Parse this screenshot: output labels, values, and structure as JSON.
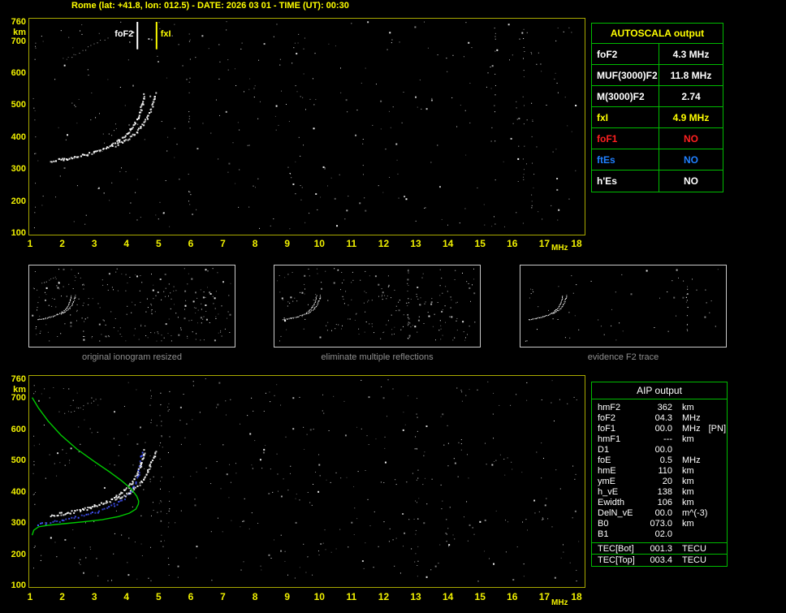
{
  "title": "Rome (lat: +41.8, lon: 012.5) - DATE: 2026 03 01 - TIME (UT): 00:30",
  "colors": {
    "axis_label": "#f0f000",
    "plot_border": "#a8a800",
    "table_border": "#00bb00",
    "trace": "#ffffff",
    "profile": "#00cc00",
    "restored_trace": "#4455ff",
    "caption": "#8f8f8f"
  },
  "autoscala_table": {
    "header": "AUTOSCALA output",
    "rows": [
      {
        "label": "foF2",
        "value": "4.3 MHz",
        "color": "#ffffff"
      },
      {
        "label": "MUF(3000)F2",
        "value": "11.8 MHz",
        "color": "#ffffff"
      },
      {
        "label": "M(3000)F2",
        "value": "2.74",
        "color": "#ffffff"
      },
      {
        "label": "fxI",
        "value": "4.9 MHz",
        "color": "#ffff00"
      },
      {
        "label": "foF1",
        "value": "NO",
        "color": "#ff2020"
      },
      {
        "label": "ftEs",
        "value": "NO",
        "color": "#2080ff"
      },
      {
        "label": "h'Es",
        "value": "NO",
        "color": "#ffffff"
      }
    ]
  },
  "aip_table": {
    "header": "AIP output",
    "rows": [
      {
        "label": "hmF2",
        "value": "362",
        "unit": "km",
        "note": ""
      },
      {
        "label": "foF2",
        "value": "04.3",
        "unit": "MHz",
        "note": ""
      },
      {
        "label": "foF1",
        "value": "00.0",
        "unit": "MHz",
        "note": "[PN]"
      },
      {
        "label": "hmF1",
        "value": "---",
        "unit": "km",
        "note": ""
      },
      {
        "label": "D1",
        "value": "00.0",
        "unit": "",
        "note": ""
      },
      {
        "label": "foE",
        "value": "0.5",
        "unit": "MHz",
        "note": ""
      },
      {
        "label": "hmE",
        "value": "110",
        "unit": "km",
        "note": ""
      },
      {
        "label": "ymE",
        "value": "20",
        "unit": "km",
        "note": ""
      },
      {
        "label": "h_vE",
        "value": "138",
        "unit": "km",
        "note": ""
      },
      {
        "label": "Ewidth",
        "value": "106",
        "unit": "km",
        "note": ""
      },
      {
        "label": "DelN_vE",
        "value": "00.0",
        "unit": "m^(-3)",
        "note": ""
      },
      {
        "label": "B0",
        "value": "073.0",
        "unit": "km",
        "note": ""
      },
      {
        "label": "B1",
        "value": "02.0",
        "unit": "",
        "note": ""
      }
    ],
    "tec_rows": [
      {
        "label": "TEC[Bot]",
        "value": "001.3",
        "unit": "TECU"
      },
      {
        "label": "TEC[Top]",
        "value": "003.4",
        "unit": "TECU"
      }
    ]
  },
  "thumbnails": [
    {
      "caption": "original ionogram resized"
    },
    {
      "caption": "eliminate multiple reflections"
    },
    {
      "caption": "evidence F2 trace"
    }
  ],
  "chart_data": [
    {
      "id": "ionogram_top",
      "type": "scatter",
      "title": "recorded ionogram",
      "xlabel": "MHz",
      "ylabel": "km",
      "xlim": [
        1,
        18
      ],
      "ylim": [
        100,
        760
      ],
      "xticks": [
        1,
        2,
        3,
        4,
        5,
        6,
        7,
        8,
        9,
        10,
        11,
        12,
        13,
        14,
        15,
        16,
        17,
        18
      ],
      "yticks": [
        760,
        700,
        600,
        500,
        400,
        300,
        200,
        100
      ],
      "grid": false,
      "markers": [
        {
          "label": "foF2",
          "freq_mhz": 4.3,
          "color": "#ffffff"
        },
        {
          "label": "fxI",
          "freq_mhz": 4.9,
          "color": "#ffff00"
        }
      ],
      "series": [
        {
          "name": "second-hop-reflection",
          "color": "#e8e8e8",
          "draw": "faint",
          "points": [
            [
              1.95,
              648
            ],
            [
              2.15,
              655
            ],
            [
              2.35,
              663
            ],
            [
              2.55,
              673
            ],
            [
              2.75,
              684
            ],
            [
              2.95,
              696
            ],
            [
              3.15,
              707
            ],
            [
              3.4,
              716
            ]
          ]
        },
        {
          "name": "F2-trace-ordinary",
          "color": "#ffffff",
          "draw": "dots",
          "points": [
            [
              1.55,
              328
            ],
            [
              1.7,
              330
            ],
            [
              1.9,
              333
            ],
            [
              2.1,
              336
            ],
            [
              2.3,
              340
            ],
            [
              2.5,
              345
            ],
            [
              2.7,
              350
            ],
            [
              2.9,
              356
            ],
            [
              3.1,
              363
            ],
            [
              3.3,
              371
            ],
            [
              3.5,
              381
            ],
            [
              3.7,
              393
            ],
            [
              3.85,
              405
            ],
            [
              4.0,
              419
            ],
            [
              4.1,
              432
            ],
            [
              4.2,
              448
            ],
            [
              4.3,
              466
            ],
            [
              4.38,
              487
            ],
            [
              4.44,
              508
            ],
            [
              4.48,
              527
            ],
            [
              4.5,
              538
            ]
          ]
        },
        {
          "name": "F2-trace-extraordinary",
          "color": "#ffffff",
          "draw": "dots",
          "points": [
            [
              3.6,
              378
            ],
            [
              3.8,
              388
            ],
            [
              4.0,
              400
            ],
            [
              4.2,
              414
            ],
            [
              4.35,
              430
            ],
            [
              4.5,
              449
            ],
            [
              4.6,
              468
            ],
            [
              4.7,
              490
            ],
            [
              4.78,
              512
            ],
            [
              4.83,
              530
            ],
            [
              4.85,
              540
            ]
          ]
        }
      ]
    },
    {
      "id": "ionogram_bottom",
      "type": "scatter",
      "title": "ionogram with restored trace and electron density profile",
      "xlabel": "MHz",
      "ylabel": "km",
      "xlim": [
        1,
        18
      ],
      "ylim": [
        100,
        760
      ],
      "xticks": [
        1,
        2,
        3,
        4,
        5,
        6,
        7,
        8,
        9,
        10,
        11,
        12,
        13,
        14,
        15,
        16,
        17,
        18
      ],
      "yticks": [
        760,
        700,
        600,
        500,
        400,
        300,
        200,
        100
      ],
      "grid": false,
      "markers": [],
      "series": [
        {
          "name": "second-hop-reflection",
          "color": "#e8e8e8",
          "draw": "faint",
          "points": [
            [
              2.0,
              655
            ],
            [
              2.3,
              666
            ],
            [
              2.6,
              679
            ],
            [
              2.9,
              693
            ],
            [
              3.2,
              707
            ]
          ]
        },
        {
          "name": "restored-trace",
          "color": "#4455ff",
          "draw": "sparse",
          "points": [
            [
              1.15,
              298
            ],
            [
              1.45,
              303
            ],
            [
              1.75,
              308
            ],
            [
              2.05,
              314
            ],
            [
              2.35,
              321
            ],
            [
              2.65,
              329
            ],
            [
              2.95,
              338
            ],
            [
              3.25,
              349
            ],
            [
              3.55,
              362
            ],
            [
              3.8,
              378
            ],
            [
              4.0,
              396
            ],
            [
              4.15,
              416
            ],
            [
              4.25,
              438
            ],
            [
              4.32,
              462
            ],
            [
              4.36,
              490
            ],
            [
              4.39,
              515
            ],
            [
              4.41,
              532
            ]
          ]
        },
        {
          "name": "F2-trace-ordinary",
          "color": "#ffffff",
          "draw": "dots",
          "points": [
            [
              1.55,
              328
            ],
            [
              1.7,
              330
            ],
            [
              1.9,
              333
            ],
            [
              2.1,
              336
            ],
            [
              2.3,
              340
            ],
            [
              2.5,
              345
            ],
            [
              2.7,
              350
            ],
            [
              2.9,
              356
            ],
            [
              3.1,
              363
            ],
            [
              3.3,
              371
            ],
            [
              3.5,
              381
            ],
            [
              3.7,
              393
            ],
            [
              3.85,
              405
            ],
            [
              4.0,
              419
            ],
            [
              4.1,
              432
            ],
            [
              4.2,
              448
            ],
            [
              4.3,
              466
            ],
            [
              4.38,
              487
            ],
            [
              4.44,
              508
            ],
            [
              4.48,
              527
            ],
            [
              4.5,
              538
            ]
          ]
        },
        {
          "name": "F2-trace-extraordinary",
          "color": "#ffffff",
          "draw": "dots",
          "points": [
            [
              3.6,
              378
            ],
            [
              3.8,
              388
            ],
            [
              4.0,
              400
            ],
            [
              4.2,
              414
            ],
            [
              4.35,
              430
            ],
            [
              4.5,
              449
            ],
            [
              4.6,
              468
            ],
            [
              4.7,
              490
            ],
            [
              4.78,
              512
            ],
            [
              4.83,
              530
            ],
            [
              4.85,
              540
            ]
          ]
        },
        {
          "name": "electron-density-profile",
          "color": "#00cc00",
          "draw": "line",
          "points": [
            [
              1.0,
              706
            ],
            [
              1.2,
              672
            ],
            [
              1.5,
              630
            ],
            [
              1.9,
              585
            ],
            [
              2.4,
              540
            ],
            [
              2.9,
              503
            ],
            [
              3.4,
              468
            ],
            [
              3.8,
              438
            ],
            [
              4.1,
              412
            ],
            [
              4.28,
              388
            ],
            [
              4.34,
              372
            ],
            [
              4.33,
              362
            ],
            [
              4.25,
              346
            ],
            [
              4.05,
              333
            ],
            [
              3.7,
              322
            ],
            [
              3.2,
              312
            ],
            [
              2.6,
              305
            ],
            [
              2.0,
              299
            ],
            [
              1.5,
              294
            ],
            [
              1.2,
              289
            ],
            [
              1.05,
              278
            ],
            [
              1.0,
              262
            ]
          ]
        }
      ]
    }
  ]
}
